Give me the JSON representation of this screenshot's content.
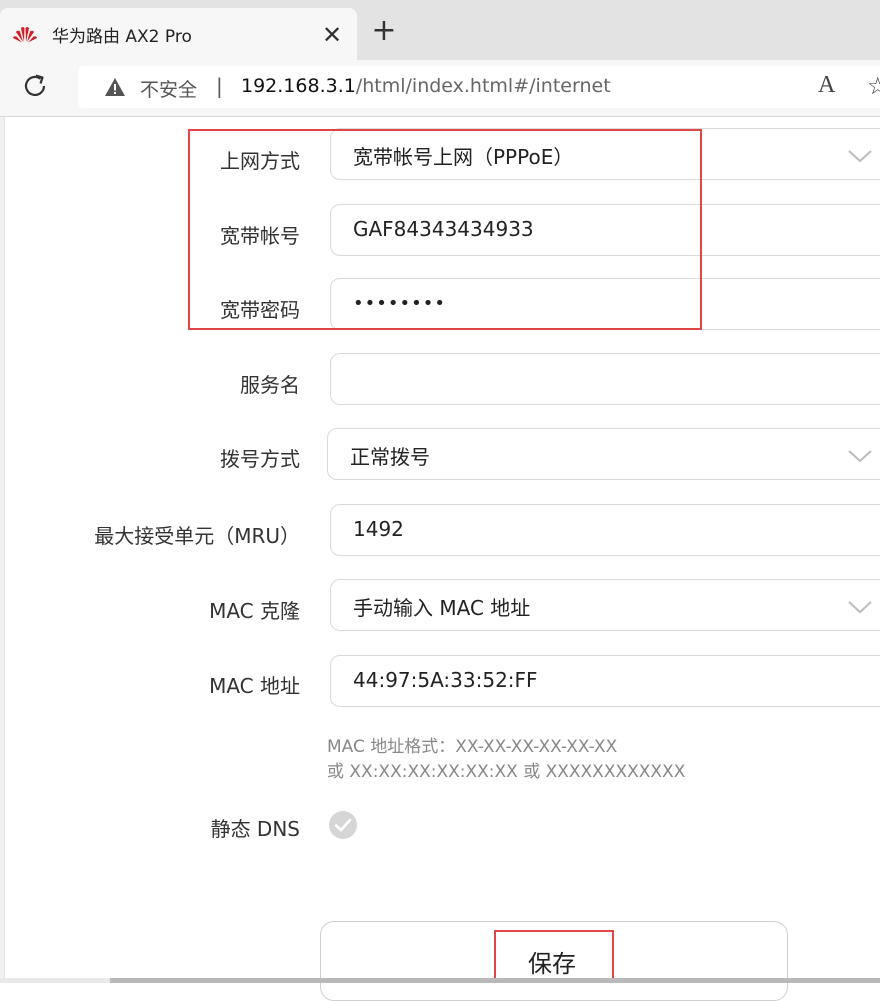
{
  "browser": {
    "tab_title": "华为路由 AX2 Pro",
    "tab_close": "✕",
    "new_tab": "+",
    "security_label": "不安全",
    "url_separator": "|",
    "url_host": "192.168.3.1",
    "url_path": "/html/index.html#/internet",
    "read_aloud": "A",
    "favorite": "☆"
  },
  "form": {
    "connection_type": {
      "label": "上网方式",
      "value": "宽带帐号上网（PPPoE）"
    },
    "account": {
      "label": "宽带帐号",
      "value": "GAF84343434933"
    },
    "password": {
      "label": "宽带密码",
      "value": "••••••••"
    },
    "service_name": {
      "label": "服务名",
      "value": ""
    },
    "dial_mode": {
      "label": "拨号方式",
      "value": "正常拨号"
    },
    "mru": {
      "label": "最大接受单元（MRU）",
      "value": "1492"
    },
    "mac_clone": {
      "label": "MAC 克隆",
      "value": "手动输入 MAC 地址"
    },
    "mac_address": {
      "label": "MAC 地址",
      "value": "44:97:5A:33:52:FF",
      "hint_line1": "MAC 地址格式：XX-XX-XX-XX-XX-XX",
      "hint_line2": "或 XX:XX:XX:XX:XX:XX 或 XXXXXXXXXXXX"
    },
    "static_dns": {
      "label": "静态 DNS",
      "checked": true
    }
  },
  "actions": {
    "save_label": "保存"
  },
  "colors": {
    "highlight": "#e04646",
    "huawei_red": "#cf1f2b",
    "hint_text": "#888888"
  }
}
